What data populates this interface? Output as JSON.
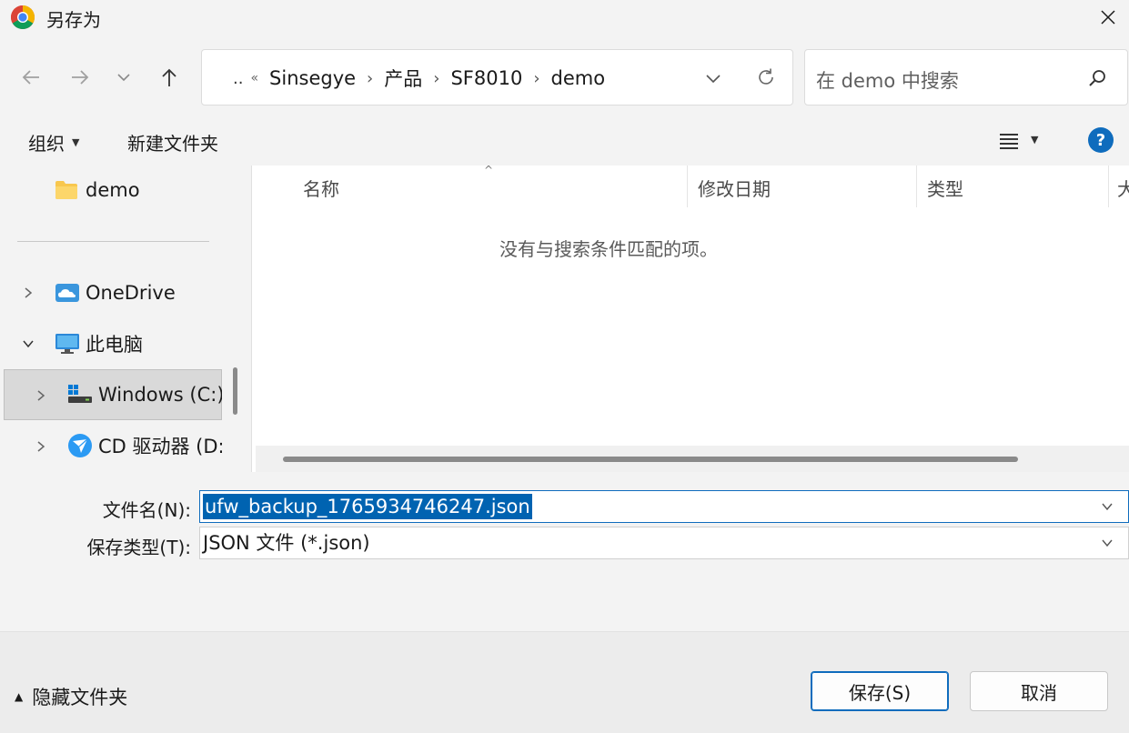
{
  "window": {
    "title": "另存为",
    "app_icon": "chrome-icon"
  },
  "nav": {
    "back_icon": "arrow-left-icon",
    "forward_icon": "arrow-right-icon",
    "recent_icon": "chevron-down-icon",
    "up_icon": "arrow-up-icon"
  },
  "address": {
    "overflow": "..",
    "overflow_chevron": "«",
    "crumbs": [
      "Sinsegye",
      "产品",
      "SF8010",
      "demo"
    ],
    "separator": "›"
  },
  "search": {
    "placeholder": "在 demo 中搜索"
  },
  "toolbar": {
    "organize_label": "组织",
    "new_folder_label": "新建文件夹",
    "help_label": "?"
  },
  "tree": {
    "items": [
      {
        "label": "demo",
        "icon": "folder-icon"
      },
      {
        "label": "OneDrive",
        "icon": "onedrive-cloud-icon"
      },
      {
        "label": "此电脑",
        "icon": "monitor-icon"
      },
      {
        "label": "Windows  (C:)",
        "icon": "windows-drive-icon"
      },
      {
        "label": "CD 驱动器 (D:)",
        "icon": "cd-drive-icon"
      }
    ]
  },
  "files": {
    "columns": [
      "名称",
      "修改日期",
      "类型",
      "大"
    ],
    "empty_message": "没有与搜索条件匹配的项。"
  },
  "form": {
    "filename_label": "文件名(N):",
    "filename_value": "ufw_backup_1765934746247.json",
    "filetype_label": "保存类型(T):",
    "filetype_value": "JSON 文件 (*.json)"
  },
  "footer": {
    "hide_folders_label": "隐藏文件夹",
    "save_label": "保存(S)",
    "cancel_label": "取消"
  },
  "colors": {
    "accent": "#0f6cbd",
    "selection": "#0063b1",
    "folder": "#f8c74e"
  }
}
